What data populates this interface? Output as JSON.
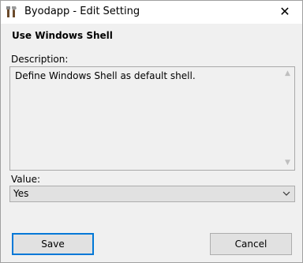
{
  "window": {
    "title": "Byodapp - Edit Setting",
    "close_glyph": "✕",
    "icon": "app-tools-icon"
  },
  "setting": {
    "name": "Use Windows Shell",
    "description_label": "Description:",
    "description": "Define Windows Shell as default shell.",
    "value_label": "Value:",
    "value": "Yes"
  },
  "buttons": {
    "save": "Save",
    "cancel": "Cancel"
  },
  "colors": {
    "accent": "#0078d7",
    "background": "#f0f0f0",
    "button": "#e1e1e1"
  }
}
